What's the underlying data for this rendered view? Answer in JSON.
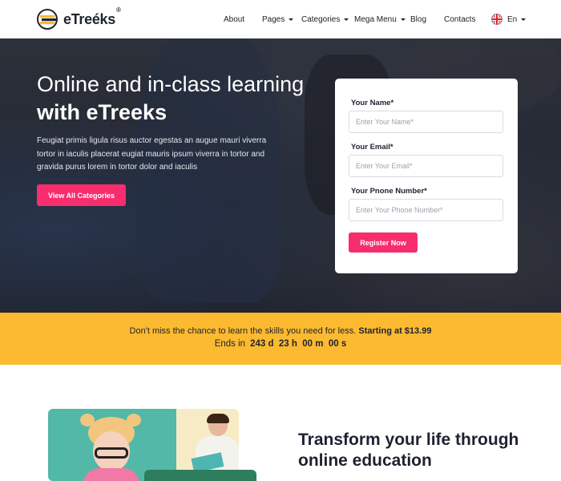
{
  "brand": {
    "name": "eTreéks",
    "reg": "®"
  },
  "nav": {
    "items": [
      {
        "label": "About",
        "dropdown": false
      },
      {
        "label": "Pages",
        "dropdown": true
      },
      {
        "label": "Categories",
        "dropdown": true
      },
      {
        "label": "Mega Menu",
        "dropdown": true
      },
      {
        "label": "Blog",
        "dropdown": false
      },
      {
        "label": "Contacts",
        "dropdown": false
      }
    ],
    "language": "En"
  },
  "hero": {
    "title_plain": "Online and in-class learning",
    "title_bold": "with eTreeks",
    "description": "Feugiat primis ligula risus auctor egestas an augue mauri viverra tortor in iaculis placerat eugiat mauris ipsum viverra in tortor and gravida purus lorem in tortor dolor and iaculis",
    "cta_label": "View All Categories"
  },
  "form": {
    "name_label": "Your Name*",
    "name_placeholder": "Enter Your Name*",
    "email_label": "Your Email*",
    "email_placeholder": "Enter Your Email*",
    "phone_label": "Your Pnone Number*",
    "phone_placeholder": "Enter Your Phone Number*",
    "submit_label": "Register Now"
  },
  "promo": {
    "text": "Don't miss the chance to learn the skills you need for less.",
    "price_text": "Starting at $13.99",
    "ends_label": "Ends in",
    "countdown": "243 d  23 h  00 m  00 s"
  },
  "section": {
    "title": "Transform your life through online education"
  },
  "colors": {
    "accent_pink": "#f72d6e",
    "promo_yellow": "#fcba30",
    "dark_text": "#1e2230"
  },
  "icons": [
    "logo-books-icon",
    "chevron-down-icon",
    "uk-flag-icon"
  ]
}
